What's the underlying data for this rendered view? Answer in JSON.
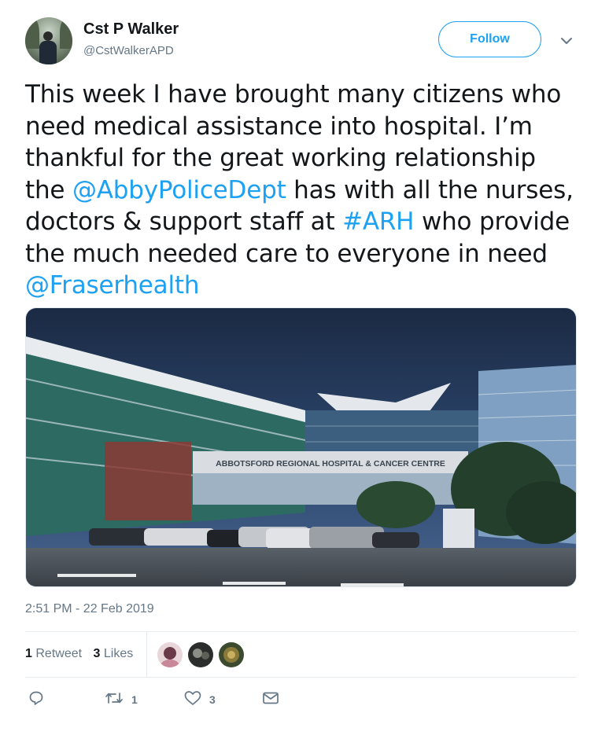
{
  "author": {
    "name": "Cst P Walker",
    "handle": "@CstWalkerAPD"
  },
  "follow_label": "Follow",
  "tweet": {
    "line1": "This week I have brought many citizens who",
    "line2": "need medical assistance into hospital. I’m",
    "line3": "thankful for the great working relationship",
    "line4_a": "the ",
    "line4_link": "@AbbyPoliceDept",
    "line4_b": " has with all the nurses,",
    "line5_a": "doctors & support staff at ",
    "line5_link": "#ARH",
    "line5_b": " who provide",
    "line6": "the much needed care to everyone in need",
    "line7_link": "@Fraserhealth"
  },
  "media": {
    "sign_text": "ABBOTSFORD REGIONAL HOSPITAL & CANCER CENTRE"
  },
  "timestamp": "2:51 PM - 22 Feb 2019",
  "stats": {
    "retweet_count": "1",
    "retweet_label": "Retweet",
    "like_count": "3",
    "like_label": "Likes"
  },
  "actions": {
    "reply_count": "",
    "retweet_count": "1",
    "like_count": "3"
  },
  "colors": {
    "link": "#1da1f2",
    "muted": "#657786",
    "text": "#14171a"
  }
}
